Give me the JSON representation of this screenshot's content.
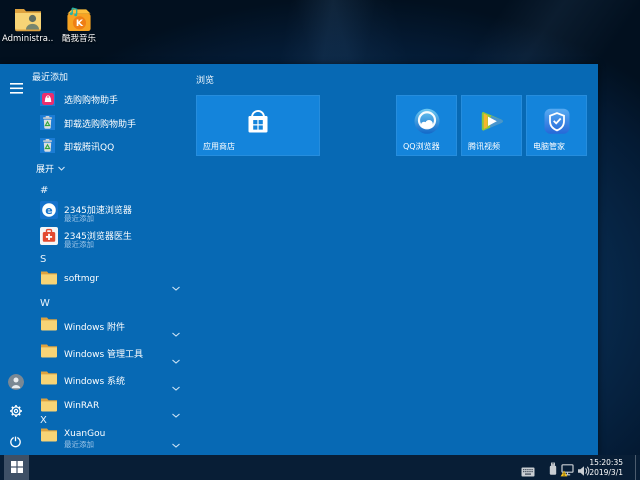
{
  "colors": {
    "accent": "#0769b4",
    "tile_blue": "#1484db",
    "icon_backplate": "#1b7cd4",
    "taskbar": "#081e36",
    "subtitle_text": "#9fc6e8"
  },
  "desktop": {
    "icons": [
      {
        "label": "Administra...",
        "icon": "administrator-folder-icon"
      },
      {
        "label": "酷我音乐",
        "icon": "kuwo-music-icon"
      }
    ]
  },
  "start_menu": {
    "recently_added": {
      "header": "最近添加",
      "items": [
        {
          "label": "选购购物助手",
          "icon": "shopping-assistant-icon"
        },
        {
          "label": "卸载选购购物助手",
          "icon": "uninstall-trash-icon"
        },
        {
          "label": "卸载腾讯QQ",
          "icon": "uninstall-trash-icon"
        }
      ]
    },
    "expand": {
      "label": "展开"
    },
    "sections": [
      {
        "letter": "#",
        "items": [
          {
            "label": "2345加速浏览器",
            "subtitle": "最近添加",
            "icon": "2345-browser-icon"
          },
          {
            "label": "2345浏览器医生",
            "subtitle": "最近添加",
            "icon": "browser-doctor-icon"
          }
        ]
      },
      {
        "letter": "S",
        "items": [
          {
            "label": "softmgr",
            "icon": "folder-icon"
          }
        ]
      },
      {
        "letter": "W",
        "items": [
          {
            "label": "Windows 附件",
            "icon": "folder-icon"
          },
          {
            "label": "Windows 管理工具",
            "icon": "folder-icon"
          },
          {
            "label": "Windows 系统",
            "icon": "folder-icon"
          },
          {
            "label": "WinRAR",
            "icon": "folder-icon"
          }
        ]
      },
      {
        "letter": "X",
        "items": [
          {
            "label": "XuanGou",
            "subtitle": "最近添加",
            "icon": "folder-icon"
          }
        ]
      }
    ],
    "tiles": {
      "group_label": "浏览",
      "items": [
        {
          "label": "应用商店",
          "size": "wide",
          "icon": "store-icon"
        },
        {
          "label": "QQ浏览器",
          "size": "medium",
          "icon": "qq-browser-icon"
        },
        {
          "label": "腾讯视频",
          "size": "medium",
          "icon": "tencent-video-icon"
        },
        {
          "label": "电脑管家",
          "size": "medium",
          "icon": "pc-manager-icon"
        }
      ]
    }
  },
  "taskbar": {
    "tray": {
      "time": "15:20:35",
      "date": "2019/3/1"
    }
  }
}
